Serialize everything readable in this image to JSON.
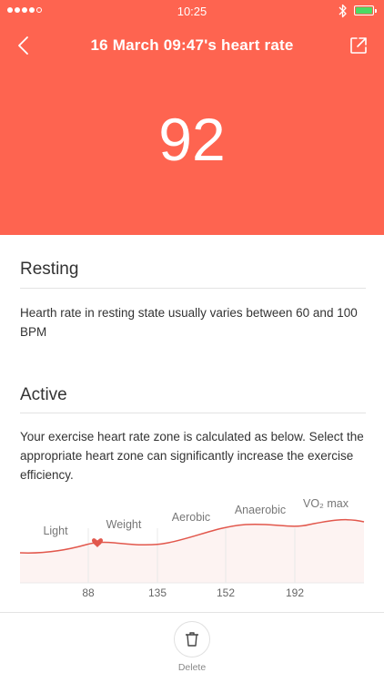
{
  "status_bar": {
    "time": "10:25",
    "signal_bars_filled": 4,
    "signal_bars_total": 5,
    "battery_level": 1.0
  },
  "header": {
    "title": "16 March 09:47's heart rate",
    "back_icon": "chevron-left-icon",
    "share_icon": "share-icon",
    "background_color": "#fe6450"
  },
  "reading": {
    "bpm": "92"
  },
  "resting": {
    "title": "Resting",
    "description": "Hearth rate in resting state usually varies between 60 and 100 BPM"
  },
  "active": {
    "title": "Active",
    "description": "Your exercise heart rate zone is calculated as below. Select the appropriate heart zone can significantly increase the exercise efficiency."
  },
  "chart_data": {
    "type": "line",
    "zones": [
      "Light",
      "Weight",
      "Aerobic",
      "Anaerobic",
      "VO₂ max"
    ],
    "boundaries": [
      88,
      135,
      152,
      192
    ],
    "marker_zone": "Weight",
    "marker_icon": "heart-icon",
    "line_color": "#e2574c"
  },
  "footer": {
    "delete_label": "Delete",
    "delete_icon": "trash-icon"
  }
}
